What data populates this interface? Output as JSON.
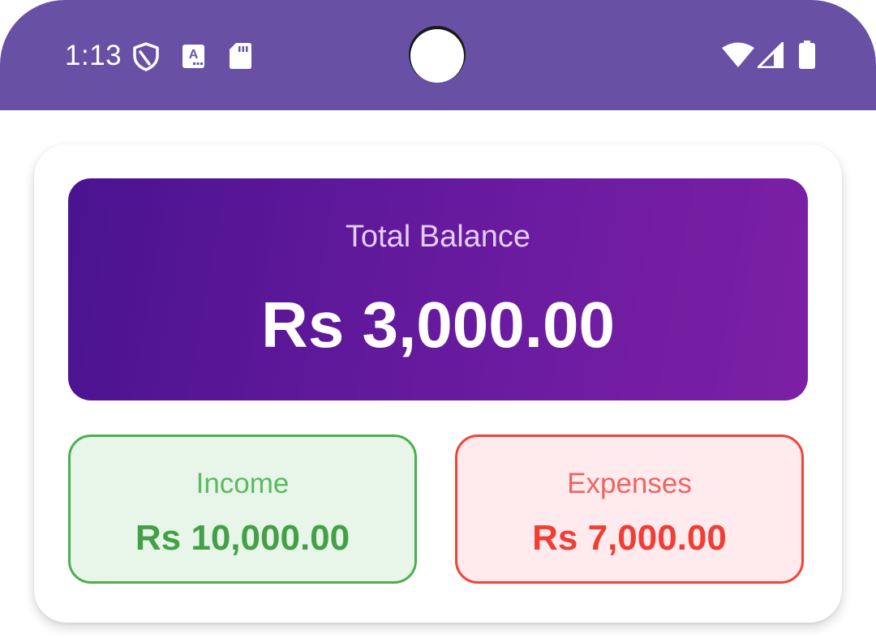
{
  "status_bar": {
    "time": "1:13",
    "background_color": "#6851a5",
    "left_icons": [
      "shield-icon",
      "keyboard-a-icon",
      "sd-card-icon"
    ],
    "right_icons": [
      "wifi-icon",
      "cellular-signal-icon",
      "battery-icon"
    ]
  },
  "balance": {
    "label": "Total Balance",
    "amount": "Rs 3,000.00",
    "gradient_colors": [
      "#4a1390",
      "#7c20a5"
    ]
  },
  "income": {
    "label": "Income",
    "amount": "Rs 10,000.00",
    "accent_color": "#4caf50",
    "background_color": "#e8f5e9"
  },
  "expenses": {
    "label": "Expenses",
    "amount": "Rs 7,000.00",
    "accent_color": "#f44336",
    "background_color": "#ffebee"
  }
}
